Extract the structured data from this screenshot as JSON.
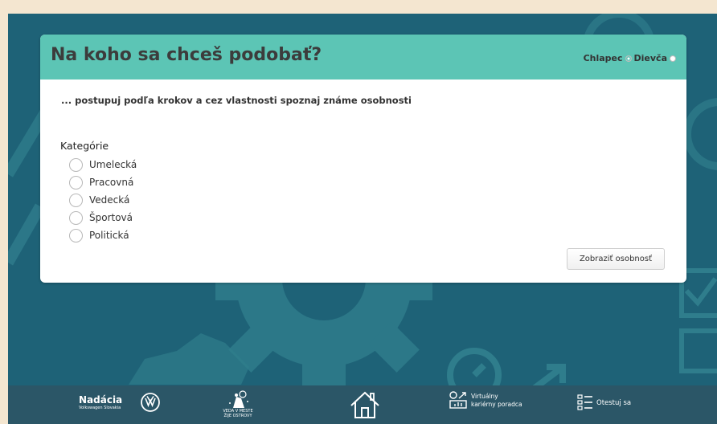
{
  "header": {
    "title": "Na koho sa chceš podobať?",
    "gender_options": [
      "Chlapec",
      "Dievča"
    ]
  },
  "subtitle": "... postupuj podľa krokov a cez vlastnosti spoznaj známe osobnosti",
  "category": {
    "label": "Kategórie",
    "options": [
      "Umelecká",
      "Pracovná",
      "Vedecká",
      "Športová",
      "Politická"
    ]
  },
  "button": {
    "label": "Zobraziť osobnosť"
  },
  "footer": {
    "nadacia_title": "Nadácia",
    "nadacia_subtitle": "Volkswagen Slovakia",
    "veda_text": "VEDA V MESTE ŽIJE OSTROVY",
    "virtual_line1": "Virtuálny",
    "virtual_line2": "kariérny poradca",
    "otestuj": "Otestuj sa"
  },
  "colors": {
    "background": "#1e6277",
    "header": "#5cc5b5",
    "footer": "#2b5667",
    "frame": "#f4e6d0"
  }
}
